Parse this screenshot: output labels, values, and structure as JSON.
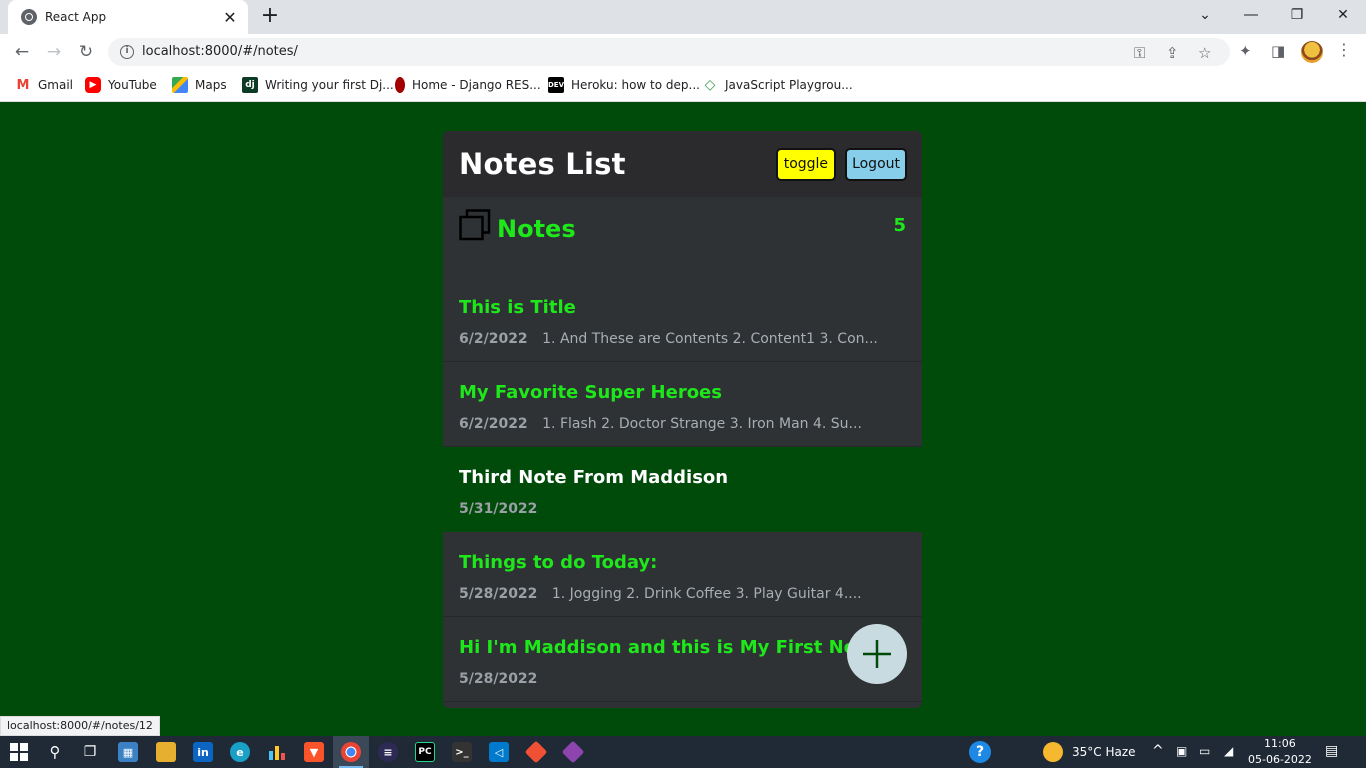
{
  "browser": {
    "tab_title": "React App",
    "tab_close": "✕",
    "new_tab": "+",
    "url": "localhost:8000/#/notes/",
    "bookmarks": [
      {
        "label": "Gmail",
        "icon": "gmail-icon"
      },
      {
        "label": "YouTube",
        "icon": "youtube-icon"
      },
      {
        "label": "Maps",
        "icon": "maps-icon"
      },
      {
        "label": "Writing your first Dj...",
        "icon": "django-icon",
        "glyph": "dj"
      },
      {
        "label": "Home - Django RES...",
        "icon": "django-rest-icon"
      },
      {
        "label": "Heroku: how to dep...",
        "icon": "dev-icon",
        "glyph": "DEV"
      },
      {
        "label": "JavaScript Playgrou...",
        "icon": "playground-icon"
      }
    ],
    "status_url": "localhost:8000/#/notes/12"
  },
  "app": {
    "title": "Notes List",
    "toggle_label": "toggle",
    "logout_label": "Logout",
    "notes_label": "Notes",
    "notes_count": "5",
    "notes": [
      {
        "title": "This is Title",
        "date": "6/2/2022",
        "preview": "1. And These are Contents 2. Content1 3. Con..."
      },
      {
        "title": "My Favorite Super Heroes",
        "date": "6/2/2022",
        "preview": "1. Flash 2. Doctor Strange 3. Iron Man 4. Su..."
      },
      {
        "title": "Third Note From Maddison",
        "date": "5/31/2022",
        "preview": ""
      },
      {
        "title": "Things to do Today:",
        "date": "5/28/2022",
        "preview": "1. Jogging 2. Drink Coffee 3. Play Guitar 4...."
      },
      {
        "title": "Hi I'm Maddison and this is My First Note",
        "date": "5/28/2022",
        "preview": ""
      }
    ],
    "colors": {
      "page_bg": "#004b09",
      "accent": "#1ee81a",
      "card_bg": "#2e3235",
      "toggle_bg": "#ffff00",
      "logout_bg": "#87ceeb"
    }
  },
  "taskbar": {
    "weather": "35°C  Haze",
    "time": "11:06",
    "date": "05-06-2022"
  }
}
